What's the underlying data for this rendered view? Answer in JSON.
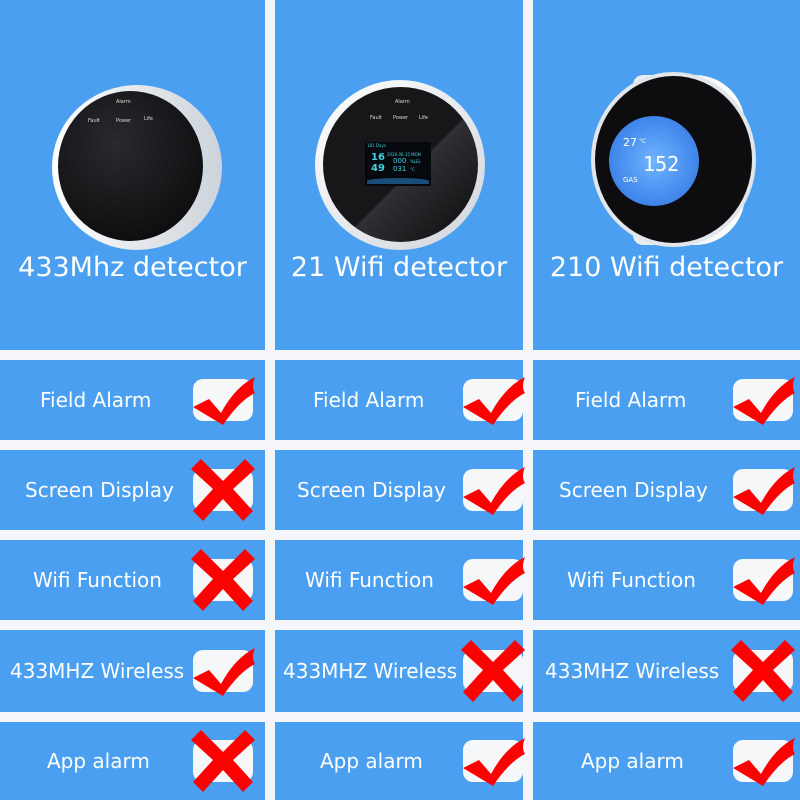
{
  "colors": {
    "panel": "#4a9ff0",
    "separator": "#f4f6f9",
    "mark": "#ff0000"
  },
  "products": [
    {
      "title": "433Mhz detector",
      "panel_labels": [
        "Alarm",
        "Fault",
        "Power",
        "Life"
      ]
    },
    {
      "title": "21 Wifi detector",
      "panel_labels": [
        "Alarm",
        "Fault",
        "Power",
        "Life"
      ],
      "screen": {
        "top": "181 Days",
        "date": "2020.06.15 MON",
        "time_h": "16",
        "time_m": "49",
        "gas": "000",
        "gas_unit": "%LEL",
        "temp": "031",
        "temp_unit": "°C"
      }
    },
    {
      "title": "210 Wifi detector",
      "screen": {
        "temp": "27",
        "temp_unit": "°C",
        "value": "152",
        "gas": "GAS"
      }
    }
  ],
  "features": [
    {
      "label": "Field Alarm",
      "values": [
        "check",
        "check",
        "check"
      ]
    },
    {
      "label": "Screen Display",
      "values": [
        "cross",
        "check",
        "check"
      ]
    },
    {
      "label": "Wifi Function",
      "values": [
        "cross",
        "check",
        "check"
      ]
    },
    {
      "label": "433MHZ Wireless",
      "values": [
        "check",
        "cross",
        "cross"
      ]
    },
    {
      "label": "App alarm",
      "values": [
        "cross",
        "check",
        "check"
      ]
    }
  ]
}
